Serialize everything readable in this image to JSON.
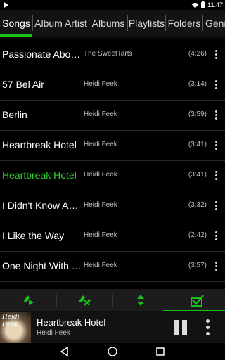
{
  "status_bar": {
    "time": "11:47",
    "icons": [
      "app-notification-icon",
      "wifi-icon",
      "battery-icon"
    ]
  },
  "tabs": [
    {
      "label": "Songs",
      "active": true
    },
    {
      "label": "Album Artist",
      "active": false
    },
    {
      "label": "Albums",
      "active": false
    },
    {
      "label": "Playlists",
      "active": false
    },
    {
      "label": "Folders",
      "active": false
    },
    {
      "label": "Genre",
      "active": false
    }
  ],
  "songs": [
    {
      "title": "Passionate About...",
      "artist": "The SweetTarts",
      "duration": "(4:26)",
      "current": false
    },
    {
      "title": "57 Bel Air",
      "artist": "Heidi Feek",
      "duration": "(3:14)",
      "current": false
    },
    {
      "title": "Berlin",
      "artist": "Heidi Feek",
      "duration": "(3:59)",
      "current": false
    },
    {
      "title": "Heartbreak Hotel",
      "artist": "Heidi Feek",
      "duration": "(3:41)",
      "current": false
    },
    {
      "title": "Heartbreak Hotel",
      "artist": "Heidi Feek",
      "duration": "(3:41)",
      "current": true
    },
    {
      "title": "I Didn't Know Abo...",
      "artist": "Heidi Feek",
      "duration": "(3:32)",
      "current": false
    },
    {
      "title": "I Like the Way",
      "artist": "Heidi Feek",
      "duration": "(2:42)",
      "current": false
    },
    {
      "title": "One Night With You",
      "artist": "Heidi Feek",
      "duration": "(3:57)",
      "current": false
    }
  ],
  "toolbar": {
    "buttons": [
      "play-all-icon",
      "shuffle-all-icon",
      "sort-icon",
      "select-mode-icon"
    ],
    "accent": "#19c219"
  },
  "now_playing": {
    "title": "Heartbreak Hotel",
    "artist": "Heidi Feek",
    "album_art_text": "Heidi Feek",
    "state": "playing"
  },
  "nav": {
    "icons": [
      "back-icon",
      "home-icon",
      "recents-icon"
    ]
  },
  "colors": {
    "accent": "#19c219",
    "current_song": "#2ecc2e",
    "background": "#000000"
  }
}
